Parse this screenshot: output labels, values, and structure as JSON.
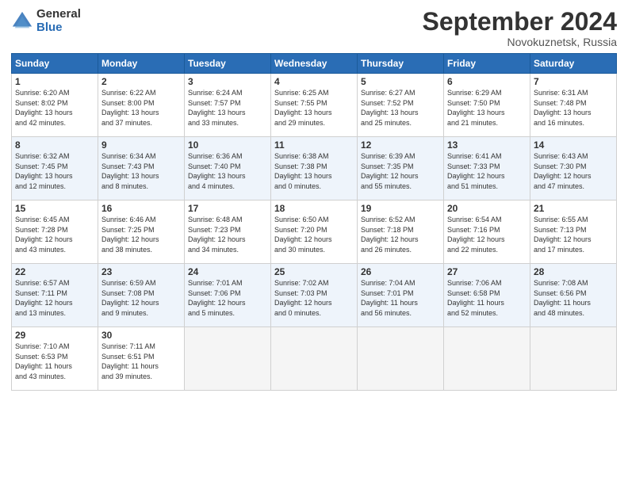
{
  "header": {
    "logo_general": "General",
    "logo_blue": "Blue",
    "month": "September 2024",
    "location": "Novokuznetsk, Russia"
  },
  "calendar": {
    "days_of_week": [
      "Sunday",
      "Monday",
      "Tuesday",
      "Wednesday",
      "Thursday",
      "Friday",
      "Saturday"
    ],
    "weeks": [
      [
        {
          "day": "1",
          "info": "Sunrise: 6:20 AM\nSunset: 8:02 PM\nDaylight: 13 hours\nand 42 minutes."
        },
        {
          "day": "2",
          "info": "Sunrise: 6:22 AM\nSunset: 8:00 PM\nDaylight: 13 hours\nand 37 minutes."
        },
        {
          "day": "3",
          "info": "Sunrise: 6:24 AM\nSunset: 7:57 PM\nDaylight: 13 hours\nand 33 minutes."
        },
        {
          "day": "4",
          "info": "Sunrise: 6:25 AM\nSunset: 7:55 PM\nDaylight: 13 hours\nand 29 minutes."
        },
        {
          "day": "5",
          "info": "Sunrise: 6:27 AM\nSunset: 7:52 PM\nDaylight: 13 hours\nand 25 minutes."
        },
        {
          "day": "6",
          "info": "Sunrise: 6:29 AM\nSunset: 7:50 PM\nDaylight: 13 hours\nand 21 minutes."
        },
        {
          "day": "7",
          "info": "Sunrise: 6:31 AM\nSunset: 7:48 PM\nDaylight: 13 hours\nand 16 minutes."
        }
      ],
      [
        {
          "day": "8",
          "info": "Sunrise: 6:32 AM\nSunset: 7:45 PM\nDaylight: 13 hours\nand 12 minutes."
        },
        {
          "day": "9",
          "info": "Sunrise: 6:34 AM\nSunset: 7:43 PM\nDaylight: 13 hours\nand 8 minutes."
        },
        {
          "day": "10",
          "info": "Sunrise: 6:36 AM\nSunset: 7:40 PM\nDaylight: 13 hours\nand 4 minutes."
        },
        {
          "day": "11",
          "info": "Sunrise: 6:38 AM\nSunset: 7:38 PM\nDaylight: 13 hours\nand 0 minutes."
        },
        {
          "day": "12",
          "info": "Sunrise: 6:39 AM\nSunset: 7:35 PM\nDaylight: 12 hours\nand 55 minutes."
        },
        {
          "day": "13",
          "info": "Sunrise: 6:41 AM\nSunset: 7:33 PM\nDaylight: 12 hours\nand 51 minutes."
        },
        {
          "day": "14",
          "info": "Sunrise: 6:43 AM\nSunset: 7:30 PM\nDaylight: 12 hours\nand 47 minutes."
        }
      ],
      [
        {
          "day": "15",
          "info": "Sunrise: 6:45 AM\nSunset: 7:28 PM\nDaylight: 12 hours\nand 43 minutes."
        },
        {
          "day": "16",
          "info": "Sunrise: 6:46 AM\nSunset: 7:25 PM\nDaylight: 12 hours\nand 38 minutes."
        },
        {
          "day": "17",
          "info": "Sunrise: 6:48 AM\nSunset: 7:23 PM\nDaylight: 12 hours\nand 34 minutes."
        },
        {
          "day": "18",
          "info": "Sunrise: 6:50 AM\nSunset: 7:20 PM\nDaylight: 12 hours\nand 30 minutes."
        },
        {
          "day": "19",
          "info": "Sunrise: 6:52 AM\nSunset: 7:18 PM\nDaylight: 12 hours\nand 26 minutes."
        },
        {
          "day": "20",
          "info": "Sunrise: 6:54 AM\nSunset: 7:16 PM\nDaylight: 12 hours\nand 22 minutes."
        },
        {
          "day": "21",
          "info": "Sunrise: 6:55 AM\nSunset: 7:13 PM\nDaylight: 12 hours\nand 17 minutes."
        }
      ],
      [
        {
          "day": "22",
          "info": "Sunrise: 6:57 AM\nSunset: 7:11 PM\nDaylight: 12 hours\nand 13 minutes."
        },
        {
          "day": "23",
          "info": "Sunrise: 6:59 AM\nSunset: 7:08 PM\nDaylight: 12 hours\nand 9 minutes."
        },
        {
          "day": "24",
          "info": "Sunrise: 7:01 AM\nSunset: 7:06 PM\nDaylight: 12 hours\nand 5 minutes."
        },
        {
          "day": "25",
          "info": "Sunrise: 7:02 AM\nSunset: 7:03 PM\nDaylight: 12 hours\nand 0 minutes."
        },
        {
          "day": "26",
          "info": "Sunrise: 7:04 AM\nSunset: 7:01 PM\nDaylight: 11 hours\nand 56 minutes."
        },
        {
          "day": "27",
          "info": "Sunrise: 7:06 AM\nSunset: 6:58 PM\nDaylight: 11 hours\nand 52 minutes."
        },
        {
          "day": "28",
          "info": "Sunrise: 7:08 AM\nSunset: 6:56 PM\nDaylight: 11 hours\nand 48 minutes."
        }
      ],
      [
        {
          "day": "29",
          "info": "Sunrise: 7:10 AM\nSunset: 6:53 PM\nDaylight: 11 hours\nand 43 minutes."
        },
        {
          "day": "30",
          "info": "Sunrise: 7:11 AM\nSunset: 6:51 PM\nDaylight: 11 hours\nand 39 minutes."
        },
        {
          "day": "",
          "info": ""
        },
        {
          "day": "",
          "info": ""
        },
        {
          "day": "",
          "info": ""
        },
        {
          "day": "",
          "info": ""
        },
        {
          "day": "",
          "info": ""
        }
      ]
    ]
  }
}
